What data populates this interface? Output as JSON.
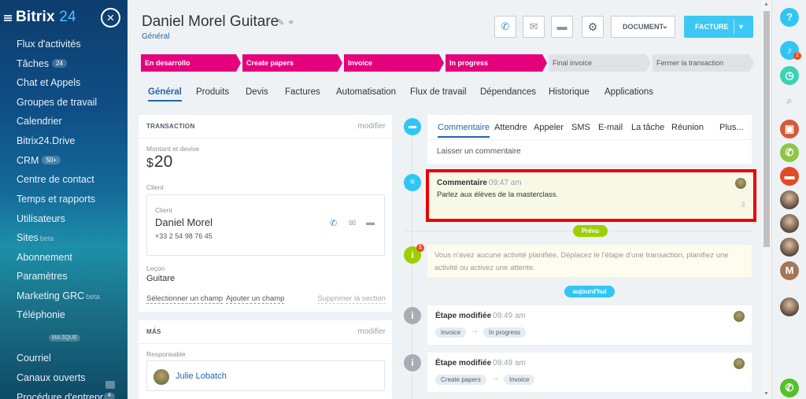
{
  "sidebar": {
    "logo": "Bitrix",
    "logo_num": "24",
    "close_icon": "×",
    "items": [
      {
        "label": "Flux d'activités"
      },
      {
        "label": "Tâches",
        "badge": "24"
      },
      {
        "label": "Chat et Appels"
      },
      {
        "label": "Groupes de travail"
      },
      {
        "label": "Calendrier"
      },
      {
        "label": "Bitrix24.Drive"
      },
      {
        "label": "CRM",
        "badge": "50+"
      },
      {
        "label": "Centre de contact"
      },
      {
        "label": "Temps et rapports"
      },
      {
        "label": "Utilisateurs"
      },
      {
        "label": "Sites",
        "beta": "beta"
      },
      {
        "label": "Abonnement"
      },
      {
        "label": "Paramètres"
      },
      {
        "label": "Marketing GRC",
        "beta": "beta"
      },
      {
        "label": "Téléphonie"
      },
      {
        "label": "Courriel"
      },
      {
        "label": "Canaux ouverts"
      },
      {
        "label": "Procédure d'entrepr"
      }
    ],
    "section_label": "MA SQUE"
  },
  "header": {
    "title": "Daniel Morel Guitare",
    "subtitle": "Général",
    "document_button": "DOCUMENT",
    "facture_button": "FACTURE"
  },
  "stages": [
    {
      "label": "En desarrollo",
      "status": "done"
    },
    {
      "label": "Create papers",
      "status": "done"
    },
    {
      "label": "Invoice",
      "status": "done"
    },
    {
      "label": "In progress",
      "status": "done"
    },
    {
      "label": "Final invoice",
      "status": "todo"
    },
    {
      "label": "Fermer la transaction",
      "status": "todo"
    }
  ],
  "stage_colors": {
    "done": "#e5007d",
    "todo": "#dfe2e5"
  },
  "tabs": [
    "Général",
    "Produits",
    "Devis",
    "Factures",
    "Automatisation",
    "Flux de travail",
    "Dépendances",
    "Historique",
    "Applications"
  ],
  "transaction": {
    "title": "TRANSACTION",
    "edit": "modifier",
    "amount_label": "Montant et devise",
    "currency": "$",
    "amount": "20",
    "client_label": "Client",
    "client_inner_label": "Client",
    "client_name": "Daniel Morel",
    "client_phone": "+33 2 54 98 76 45",
    "lecon_label": "Leçon",
    "lecon_value": "Guitare",
    "select_field": "Sélectionner un champ",
    "add_field": "Ajouter un champ",
    "delete_section": "Supprimer la section"
  },
  "mas": {
    "title": "MÁS",
    "edit": "modifier",
    "resp_label": "Responsable",
    "resp_name": "Julie Lobatch"
  },
  "composer": {
    "tabs": [
      "Commentaire",
      "Attendre",
      "Appeler",
      "SMS",
      "E-mail",
      "La tâche",
      "Réunion",
      "Plus..."
    ],
    "placeholder": "Laisser un commentaire"
  },
  "comment": {
    "title": "Commentaire",
    "time": "09:47 am",
    "text": "Parlez aux élèves de la masterclass."
  },
  "prevu": "Prévu",
  "info": {
    "badge": "1",
    "text": "Vous n'avez aucune activité planifiée. Déplacez le l'étape d'une transaction, planifiez une activité ou activez une attente."
  },
  "aujourdhui": "aujourd'hui",
  "stage_events": [
    {
      "title": "Étape modifiée",
      "time": "09:49 am",
      "from": "Invoice",
      "to": "In progress"
    },
    {
      "title": "Étape modifiée",
      "time": "09:49 am",
      "from": "Create papers",
      "to": "Invoice"
    }
  ],
  "rightbar": {
    "help": "?",
    "notif_count": "2",
    "avatar_letter": "M"
  },
  "icons": [
    "close-icon",
    "burger-icon",
    "pencil-icon",
    "link-icon",
    "phone-icon",
    "mail-icon",
    "chat-icon",
    "gear-icon",
    "chevron-down-icon",
    "search-icon",
    "bell-icon",
    "lock-icon",
    "pin-icon"
  ]
}
